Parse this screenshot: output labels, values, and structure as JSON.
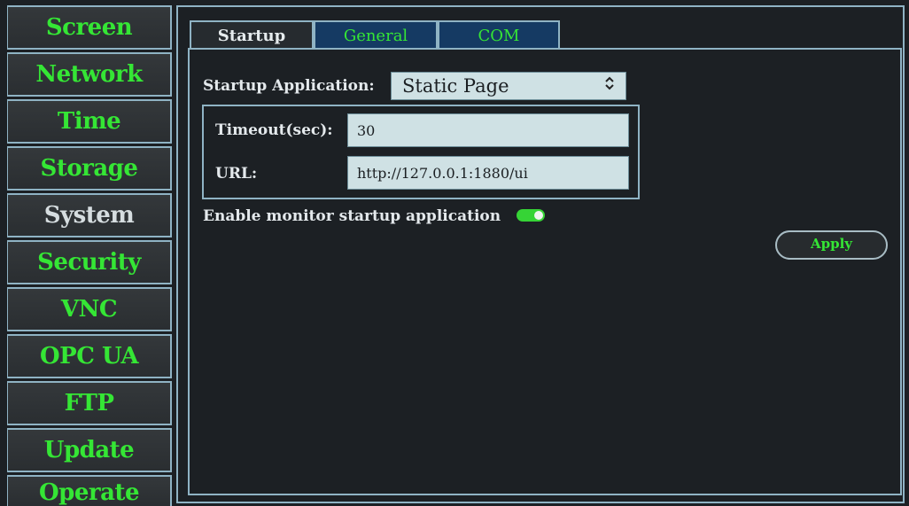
{
  "sidebar": {
    "items": [
      {
        "label": "Screen",
        "active": false
      },
      {
        "label": "Network",
        "active": false
      },
      {
        "label": "Time",
        "active": false
      },
      {
        "label": "Storage",
        "active": false
      },
      {
        "label": "System",
        "active": true
      },
      {
        "label": "Security",
        "active": false
      },
      {
        "label": "VNC",
        "active": false
      },
      {
        "label": "OPC UA",
        "active": false
      },
      {
        "label": "FTP",
        "active": false
      },
      {
        "label": "Update",
        "active": false
      },
      {
        "label": "Operate",
        "active": false
      }
    ]
  },
  "tabs": [
    {
      "label": "Startup",
      "active": true
    },
    {
      "label": "General",
      "active": false
    },
    {
      "label": "COM",
      "active": false
    }
  ],
  "startup": {
    "app_label": "Startup Application:",
    "app_value": "Static Page",
    "timeout_label": "Timeout(sec):",
    "timeout_value": "30",
    "url_label": "URL:",
    "url_value": "http://127.0.0.1:1880/ui",
    "monitor_label": "Enable monitor startup application",
    "monitor_enabled": true,
    "apply_label": "Apply"
  },
  "colors": {
    "accent_green": "#35e635",
    "border_blue": "#8fb3c4",
    "tab_inactive_bg": "#153a63",
    "input_bg": "#cfe1e4",
    "background": "#1c2024"
  },
  "icons": {
    "select_arrow": "chevron-up-down-icon"
  }
}
